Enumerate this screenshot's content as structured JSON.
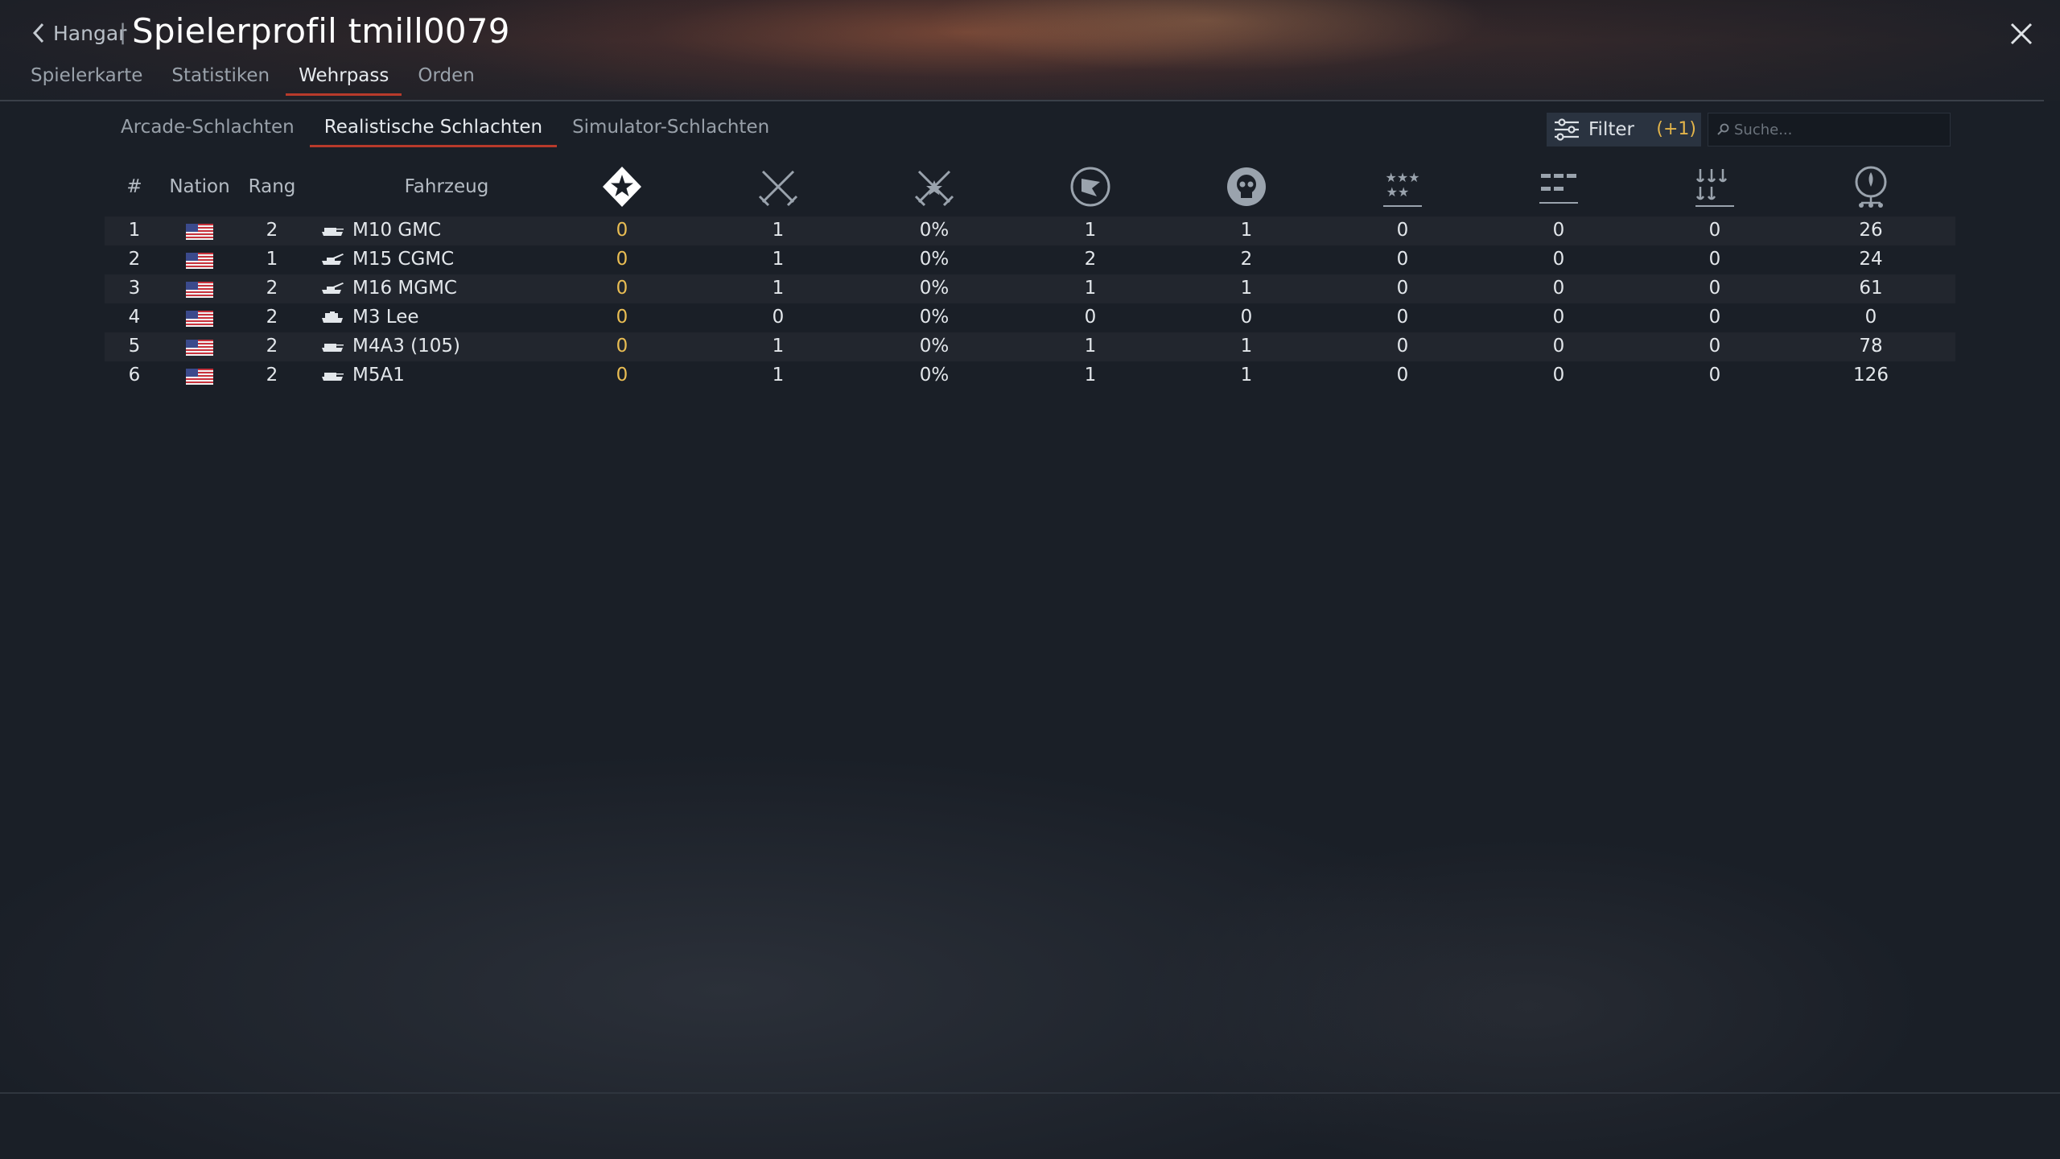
{
  "header": {
    "back_label": "Hangar",
    "separator": "|",
    "title": "Spielerprofil tmill0079"
  },
  "profile_tabs": [
    {
      "label": "Spielerkarte",
      "active": false
    },
    {
      "label": "Statistiken",
      "active": false
    },
    {
      "label": "Wehrpass",
      "active": true
    },
    {
      "label": "Orden",
      "active": false
    }
  ],
  "mode_tabs": [
    {
      "label": "Arcade-Schlachten",
      "active": false
    },
    {
      "label": "Realistische Schlachten",
      "active": true
    },
    {
      "label": "Simulator-Schlachten",
      "active": false
    }
  ],
  "filter": {
    "label": "Filter",
    "count": "(+1)"
  },
  "search": {
    "placeholder": "Suche..."
  },
  "table": {
    "headers": {
      "index": "#",
      "nation": "Nation",
      "rank": "Rang",
      "vehicle": "Fahrzeug"
    },
    "icon_columns": [
      "victories-icon",
      "battles-icon",
      "victory-ratio-icon",
      "respawns-icon",
      "deaths-icon",
      "air-kills-icon",
      "ground-kills-icon",
      "naval-kills-icon",
      "flights-icon"
    ],
    "rows": [
      {
        "index": "1",
        "nation": "USA",
        "rank": "2",
        "vehicle": "M10 GMC",
        "type": "tank",
        "values": [
          "0",
          "1",
          "0%",
          "1",
          "1",
          "0",
          "0",
          "0",
          "26"
        ]
      },
      {
        "index": "2",
        "nation": "USA",
        "rank": "1",
        "vehicle": "M15 CGMC",
        "type": "spaa",
        "values": [
          "0",
          "1",
          "0%",
          "2",
          "2",
          "0",
          "0",
          "0",
          "24"
        ]
      },
      {
        "index": "3",
        "nation": "USA",
        "rank": "2",
        "vehicle": "M16 MGMC",
        "type": "spaa",
        "values": [
          "0",
          "1",
          "0%",
          "1",
          "1",
          "0",
          "0",
          "0",
          "61"
        ]
      },
      {
        "index": "4",
        "nation": "USA",
        "rank": "2",
        "vehicle": "M3 Lee",
        "type": "heavy",
        "values": [
          "0",
          "0",
          "0%",
          "0",
          "0",
          "0",
          "0",
          "0",
          "0"
        ]
      },
      {
        "index": "5",
        "nation": "USA",
        "rank": "2",
        "vehicle": "M4A3 (105)",
        "type": "tank",
        "values": [
          "0",
          "1",
          "0%",
          "1",
          "1",
          "0",
          "0",
          "0",
          "78"
        ]
      },
      {
        "index": "6",
        "nation": "USA",
        "rank": "2",
        "vehicle": "M5A1",
        "type": "tank",
        "values": [
          "0",
          "1",
          "0%",
          "1",
          "1",
          "0",
          "0",
          "0",
          "126"
        ]
      }
    ]
  },
  "colors": {
    "accent": "#b83a2b",
    "gold": "#e9bd53",
    "background": "#1a1f27"
  }
}
